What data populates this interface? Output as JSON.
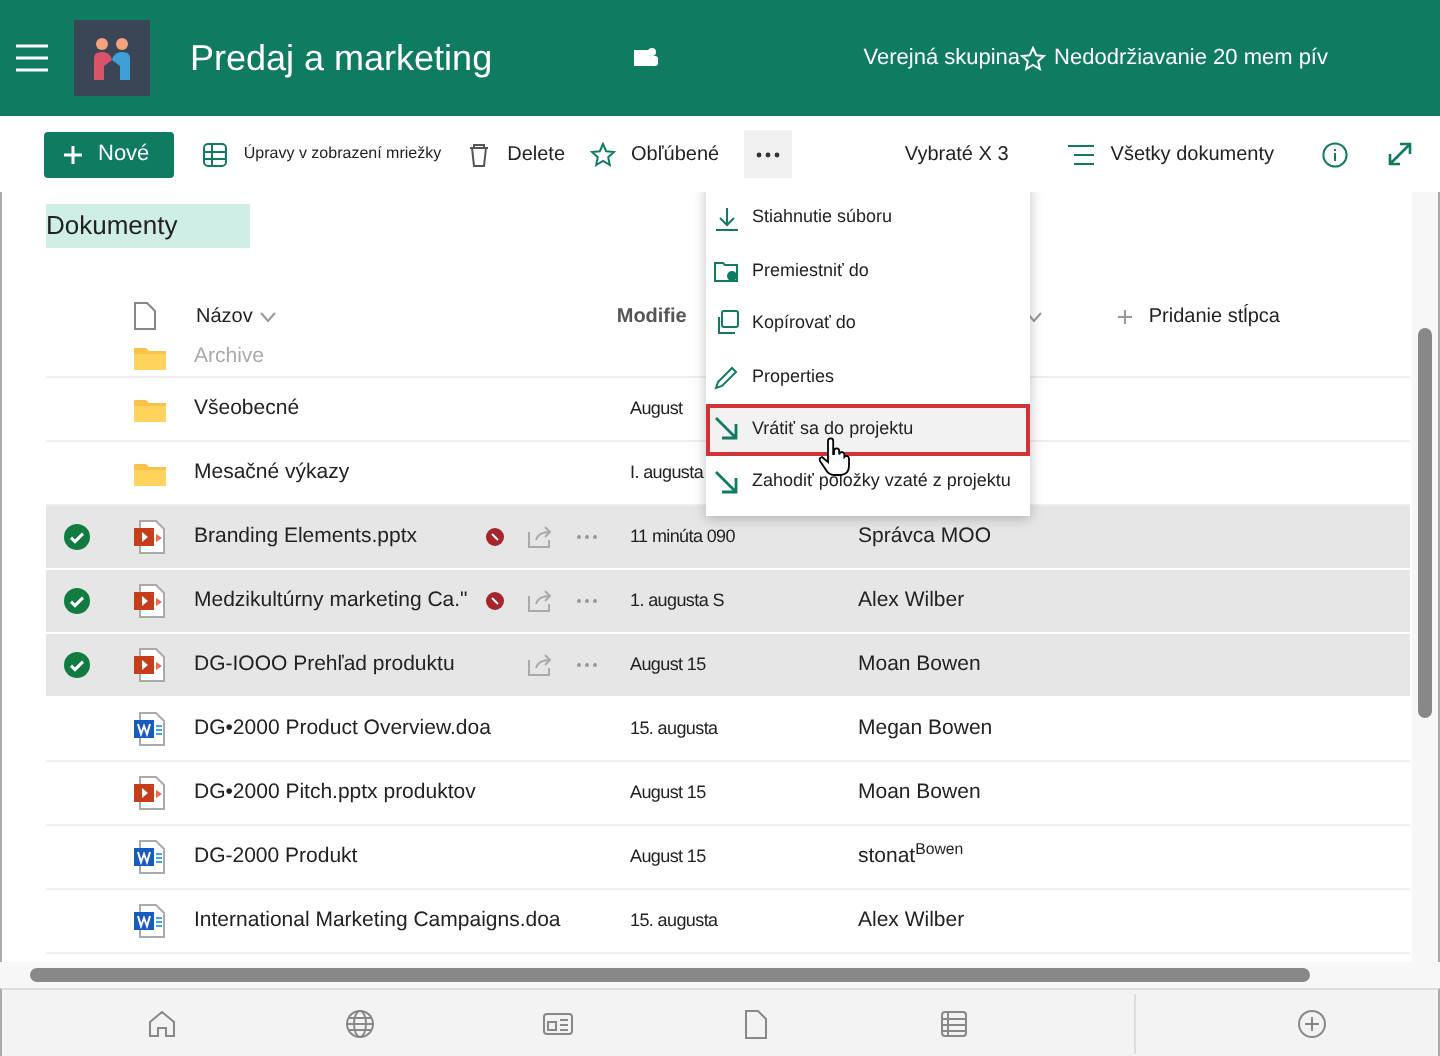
{
  "header": {
    "title": "Predaj a marketing",
    "group_type": "Verejná skupina",
    "follow": "Nedodržiavanie 20 mem pív"
  },
  "toolbar": {
    "new": "Nové",
    "commands": [
      {
        "kind": "grid",
        "label": "Úpravy v zobrazení mriežky"
      },
      {
        "kind": "delete",
        "label": "Delete"
      },
      {
        "kind": "favorite",
        "label": "Obľúbené"
      }
    ],
    "selection": "Vybraté X 3",
    "view": "Všetky dokumenty"
  },
  "library": {
    "title": "Dokumenty"
  },
  "columns": {
    "name": "Názov",
    "modified": "Modifie",
    "add": "Pridanie stĺpca"
  },
  "rows": [
    {
      "kind": "folder",
      "name": "Archive",
      "selected": false,
      "alert": false,
      "faded": true
    },
    {
      "kind": "folder",
      "name": "Všeobecné",
      "modified": "August",
      "selected": false,
      "alert": false,
      "faded": false
    },
    {
      "kind": "folder",
      "name": "Mesačné výkazy",
      "modified": "I. augusta",
      "selected": false,
      "alert": false,
      "faded": false
    },
    {
      "kind": "pptx",
      "name": "Branding Elements.pptx",
      "modified": "11 minúta 090",
      "modified_by": "Správca MOO",
      "selected": true,
      "alert": true,
      "faded": false
    },
    {
      "kind": "pptx",
      "name": "Medzikultúrny marketing Ca.\"",
      "modified": "1. augusta S",
      "modified_by": "Alex Wilber",
      "selected": true,
      "alert": true,
      "faded": false
    },
    {
      "kind": "pptx",
      "name": "DG-IOOO Prehľad produktu",
      "modified": "August 15",
      "modified_by": "Moan Bowen",
      "selected": true,
      "alert": false,
      "faded": false
    },
    {
      "kind": "docx",
      "name": "DG•2000 Product Overview.doa",
      "modified": "15. augusta",
      "modified_by": "Megan Bowen",
      "selected": false,
      "alert": false,
      "faded": false
    },
    {
      "kind": "pptx",
      "name": "DG•2000 Pitch.pptx produktov",
      "modified": "August 15",
      "modified_by": "Moan Bowen",
      "selected": false,
      "alert": false,
      "faded": false
    },
    {
      "kind": "docx",
      "name": "DG-2000 Produkt",
      "modified": "August 15",
      "modified_by": "stonat$^{Bowen}$",
      "selected": false,
      "alert": false,
      "faded": false
    },
    {
      "kind": "docx",
      "name": "International Marketing Campaigns.doa",
      "modified": "15. augusta",
      "modified_by": "Alex Wilber",
      "selected": false,
      "alert": false,
      "faded": false
    }
  ],
  "menu": {
    "items": [
      {
        "kind": "download",
        "label": "Stiahnutie súboru",
        "selected": false
      },
      {
        "kind": "move",
        "label": "Premiestniť do",
        "selected": false
      },
      {
        "kind": "copy",
        "label": "Kopírovať do",
        "selected": false
      },
      {
        "kind": "properties",
        "label": "Properties",
        "selected": false
      },
      {
        "kind": "checkin",
        "label": "Vrátiť sa do projektu",
        "selected": true
      },
      {
        "kind": "discard",
        "label": "Zahodiť položky vzaté z projektu",
        "selected": false
      }
    ]
  }
}
